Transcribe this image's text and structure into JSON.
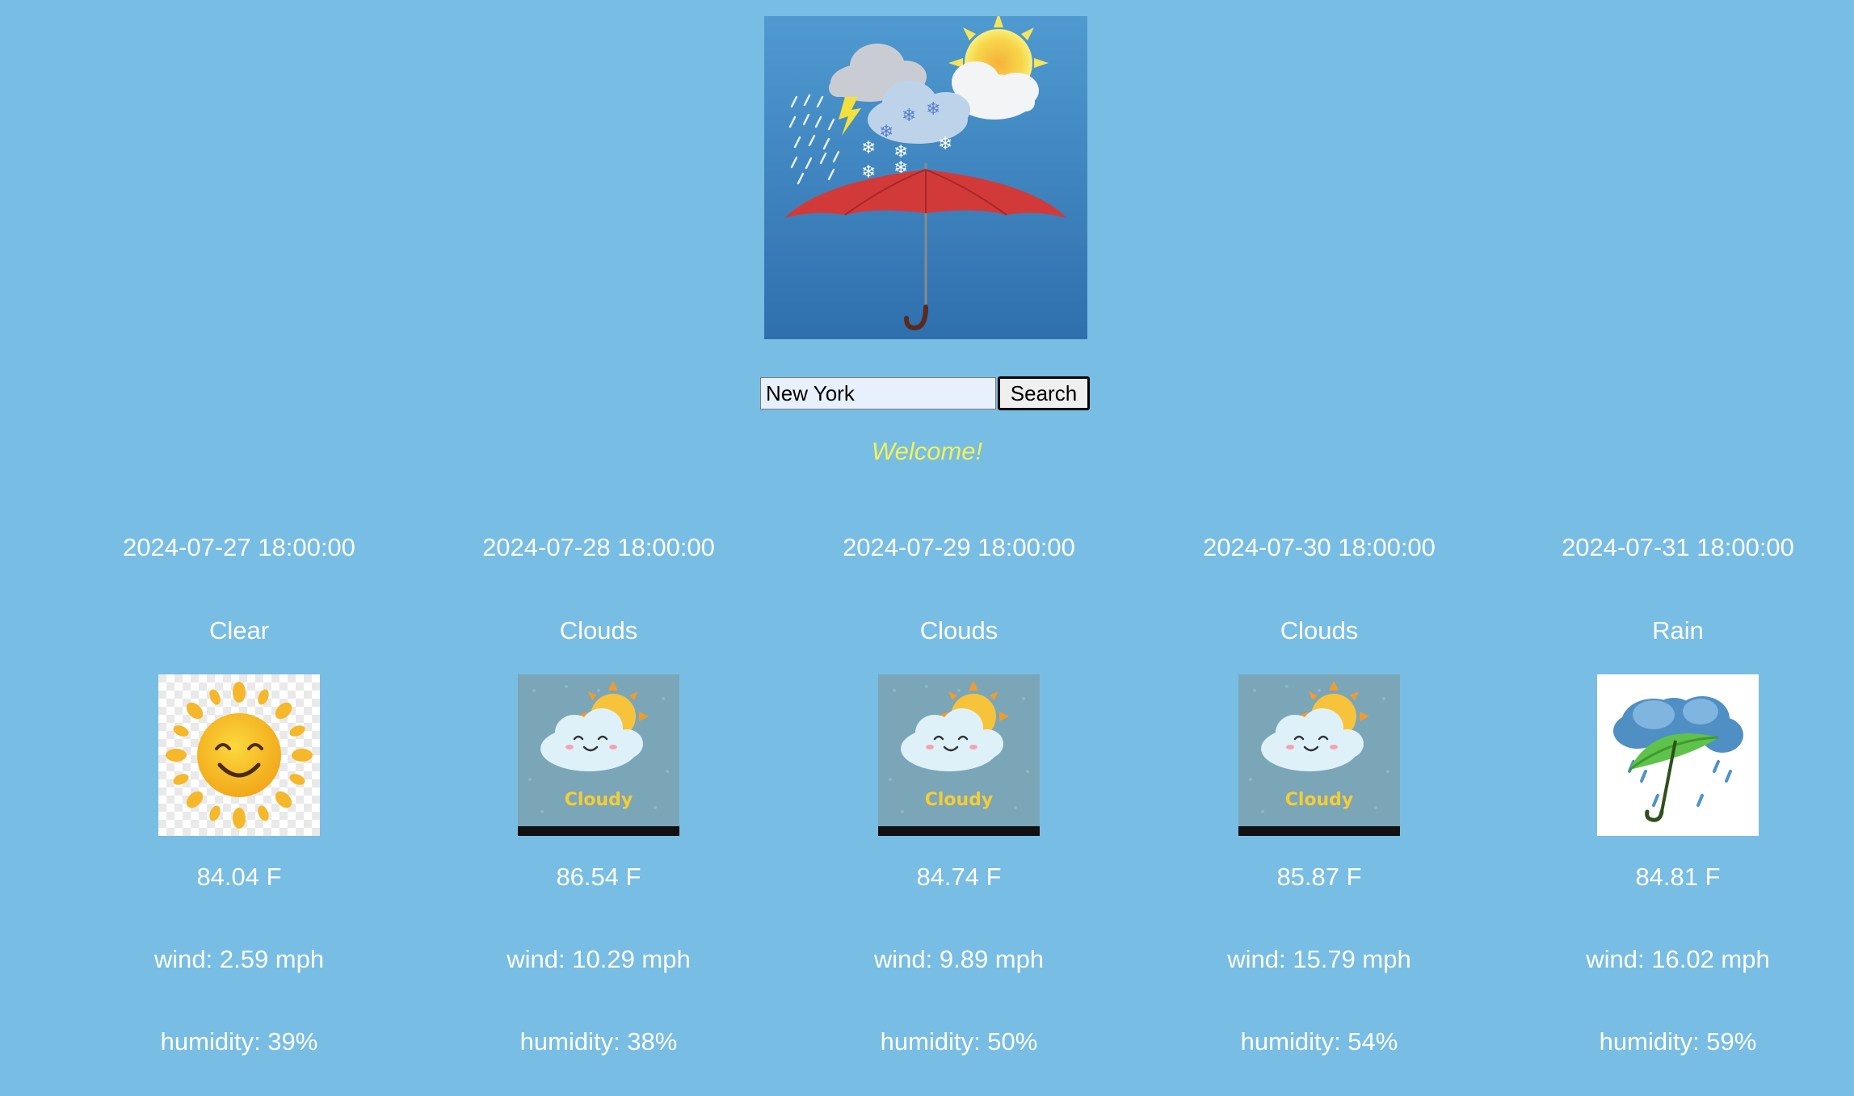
{
  "search": {
    "value": "New York",
    "button_label": "Search"
  },
  "welcome_text": "Welcome!",
  "forecast": [
    {
      "date": "2024-07-27 18:00:00",
      "condition": "Clear",
      "icon": "sun-icon",
      "temp": "84.04 F",
      "wind": "wind: 2.59 mph",
      "humidity": "humidity: 39%"
    },
    {
      "date": "2024-07-28 18:00:00",
      "condition": "Clouds",
      "icon": "cloudy-icon",
      "icon_text": "Cloudy",
      "temp": "86.54 F",
      "wind": "wind: 10.29 mph",
      "humidity": "humidity: 38%"
    },
    {
      "date": "2024-07-29 18:00:00",
      "condition": "Clouds",
      "icon": "cloudy-icon",
      "icon_text": "Cloudy",
      "temp": "84.74 F",
      "wind": "wind: 9.89 mph",
      "humidity": "humidity: 50%"
    },
    {
      "date": "2024-07-30 18:00:00",
      "condition": "Clouds",
      "icon": "cloudy-icon",
      "icon_text": "Cloudy",
      "temp": "85.87 F",
      "wind": "wind: 15.79 mph",
      "humidity": "humidity: 54%"
    },
    {
      "date": "2024-07-31 18:00:00",
      "condition": "Rain",
      "icon": "rain-umbrella-icon",
      "temp": "84.81 F",
      "wind": "wind: 16.02 mph",
      "humidity": "humidity: 59%"
    }
  ],
  "colors": {
    "background": "#78bde3",
    "welcome": "#f3f25a",
    "text": "#ffffff"
  }
}
